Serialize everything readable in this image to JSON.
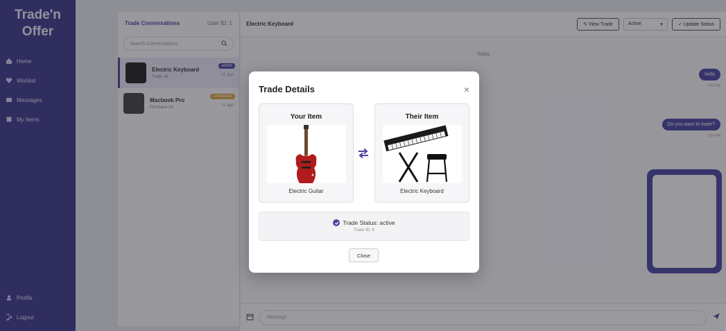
{
  "sidebar": {
    "brand_line1": "Trade'n",
    "brand_line2": "Offer",
    "items": [
      {
        "label": "Home",
        "icon": "home-icon"
      },
      {
        "label": "Wishlist",
        "icon": "heart-icon"
      },
      {
        "label": "Messages",
        "icon": "message-icon"
      },
      {
        "label": "My Items",
        "icon": "box-icon"
      }
    ],
    "bottom_items": [
      {
        "label": "Profile",
        "icon": "user-icon"
      },
      {
        "label": "Logout",
        "icon": "logout-icon"
      }
    ]
  },
  "conversations": {
    "title": "Trade Conversations",
    "user_label": "User ID: 1",
    "search_placeholder": "Search Conversations...",
    "items": [
      {
        "name": "Electric Keyboard",
        "sub": "Trade #8",
        "badge": "active",
        "badge_color": "#4a46a0",
        "time": "11 ago"
      },
      {
        "name": "Macbook Pro",
        "sub": "Purchase #4",
        "badge": "completed",
        "badge_color": "#e0a43a",
        "time": "11 ago"
      }
    ]
  },
  "chat": {
    "title": "Electric Keyboard",
    "view_trade_label": "View Trade",
    "status_select": "Active",
    "update_status_label": "Update Status",
    "day_label": "Today",
    "messages": [
      {
        "text": "hello",
        "time": "1:04 PM"
      },
      {
        "text": "Do you want to trade?",
        "time": "1:04 PM"
      }
    ],
    "input_placeholder": "Message"
  },
  "modal": {
    "title": "Trade Details",
    "close_x": "×",
    "your_item_heading": "Your Item",
    "your_item_name": "Electric Guitar",
    "their_item_heading": "Their Item",
    "their_item_name": "Electric Keyboard",
    "status_text": "Trade Status: active",
    "trade_id": "Trade ID: 8",
    "close_button": "Close"
  },
  "colors": {
    "accent": "#4a46a0",
    "sidebar": "#3f3a8c",
    "guitar_body": "#b01b1b"
  }
}
